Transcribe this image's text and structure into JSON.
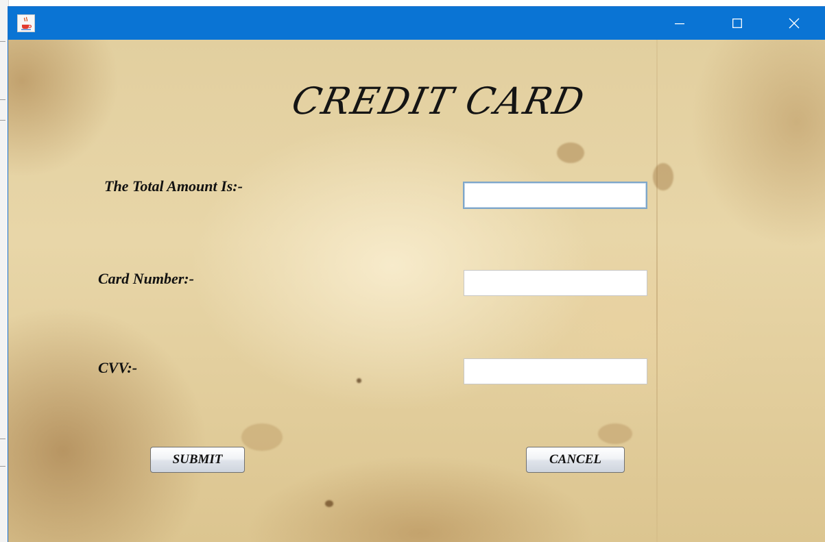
{
  "window": {
    "icon": "java-coffee-cup-icon",
    "controls": {
      "minimize_icon": "minimize-icon",
      "maximize_icon": "maximize-icon",
      "close_icon": "close-icon"
    },
    "titlebar_color": "#0a74d4"
  },
  "form": {
    "heading": "CREDIT CARD",
    "fields": {
      "total_amount": {
        "label": "The Total Amount Is:-",
        "value": ""
      },
      "card_number": {
        "label": "Card Number:-",
        "value": ""
      },
      "cvv": {
        "label": "CVV:-",
        "value": ""
      }
    },
    "buttons": {
      "submit_label": "SUBMIT",
      "cancel_label": "CANCEL"
    }
  }
}
